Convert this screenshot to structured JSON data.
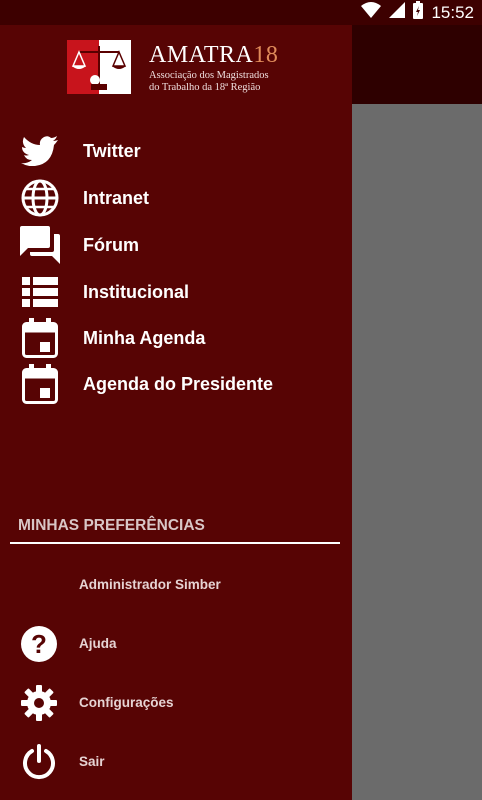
{
  "status_bar": {
    "time": "15:52"
  },
  "logo": {
    "title": "AMATRA",
    "title_number": "18",
    "subtitle_line1": "Associação dos Magistrados",
    "subtitle_line2": "do Trabalho da 18ª Região"
  },
  "menu": {
    "items": [
      {
        "label": "Twitter",
        "icon": "twitter-icon"
      },
      {
        "label": "Intranet",
        "icon": "globe-icon"
      },
      {
        "label": "Fórum",
        "icon": "forum-icon"
      },
      {
        "label": "Institucional",
        "icon": "list-icon"
      },
      {
        "label": "Minha Agenda",
        "icon": "calendar-icon"
      },
      {
        "label": "Agenda do Presidente",
        "icon": "calendar-icon"
      }
    ]
  },
  "preferences": {
    "title": "MINHAS PREFERÊNCIAS",
    "items": [
      {
        "label": "Administrador Simber",
        "icon": ""
      },
      {
        "label": "Ajuda",
        "icon": "help-icon"
      },
      {
        "label": "Configurações",
        "icon": "gear-icon"
      },
      {
        "label": "Sair",
        "icon": "power-icon"
      }
    ]
  },
  "colors": {
    "drawer": "#570404",
    "status_bar": "#3d0000",
    "app_bar": "#2e0000",
    "scrim": "#6b6b6b"
  }
}
